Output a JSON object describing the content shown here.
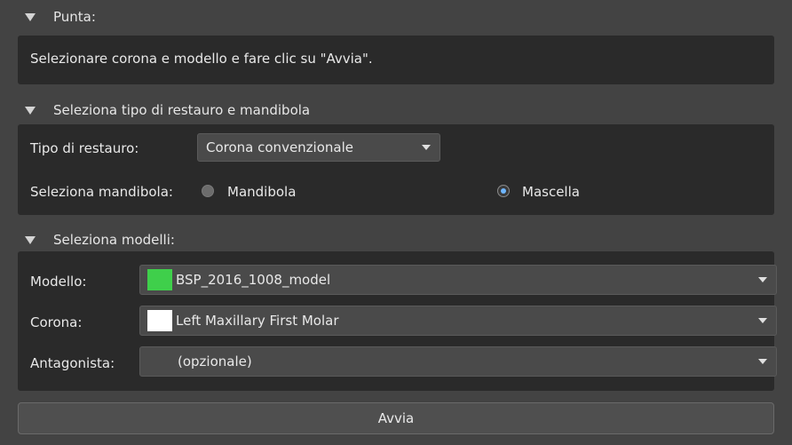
{
  "hint_section": {
    "title": "Punta:",
    "text": "Selezionare corona e modello e fare clic su \"Avvia\"."
  },
  "restoration_section": {
    "title": "Seleziona tipo di restauro e mandibola",
    "type_label": "Tipo di restauro:",
    "type_value": "Corona convenzionale",
    "jaw_label": "Seleziona mandibola:",
    "jaw_options": [
      {
        "label": "Mandibola",
        "checked": false
      },
      {
        "label": "Mascella",
        "checked": true
      }
    ]
  },
  "models_section": {
    "title": "Seleziona modelli:",
    "rows": [
      {
        "label": "Modello:",
        "value": "BSP_2016_1008_model",
        "swatch": "#3fcf4b"
      },
      {
        "label": "Corona:",
        "value": "Left Maxillary First Molar",
        "swatch": "#ffffff"
      },
      {
        "label": "Antagonista:",
        "value": "(opzionale)",
        "swatch": ""
      }
    ]
  },
  "start_button": "Avvia",
  "colors": {
    "accent_radio": "#6fb6ff",
    "background": "#434343",
    "panel": "#2a2a2a"
  }
}
